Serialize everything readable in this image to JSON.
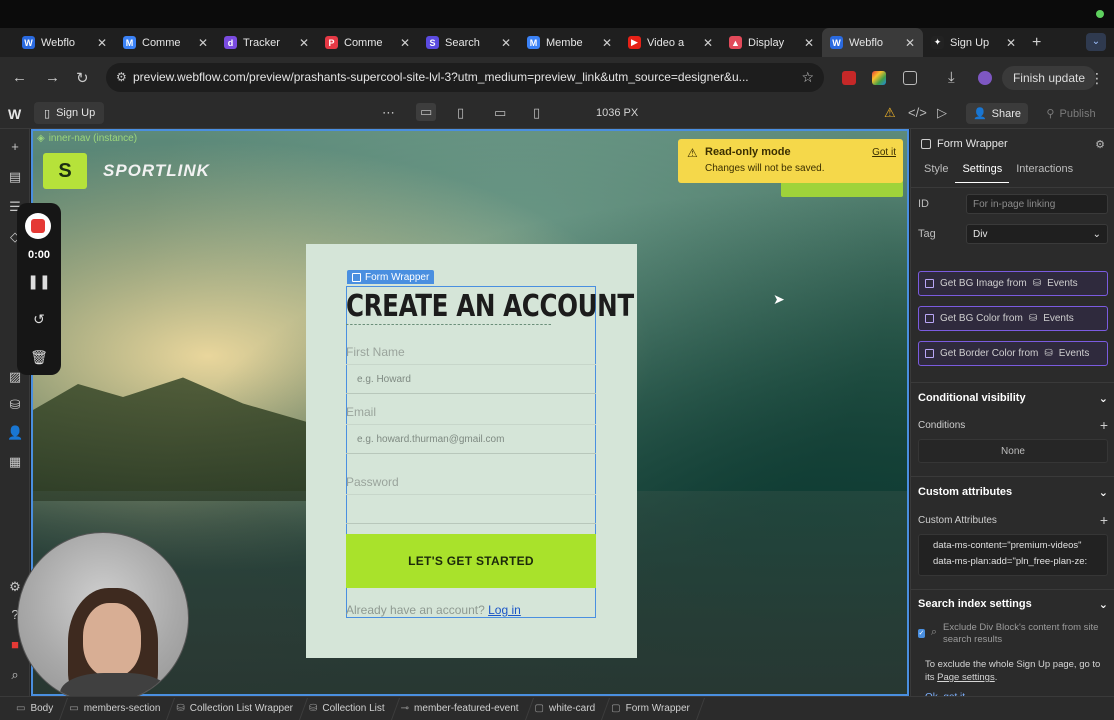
{
  "browser": {
    "tabs": [
      {
        "label": "Webflo",
        "favicon": "W",
        "color": "#2a6ae0",
        "active": false
      },
      {
        "label": "Comme",
        "favicon": "M",
        "color": "#3b82f6",
        "active": false
      },
      {
        "label": "Tracker",
        "favicon": "d",
        "color": "#7a4be0",
        "active": false
      },
      {
        "label": "Comme",
        "favicon": "P",
        "color": "#e53945",
        "active": false
      },
      {
        "label": "Search",
        "favicon": "S",
        "color": "#5b4be0",
        "active": false
      },
      {
        "label": "Membe",
        "favicon": "M",
        "color": "#3b82f6",
        "active": false
      },
      {
        "label": "Video a",
        "favicon": "▶",
        "color": "#e62117",
        "active": false
      },
      {
        "label": "Display",
        "favicon": "▲",
        "color": "#e24a5a",
        "active": false
      },
      {
        "label": "Webflo",
        "favicon": "W",
        "color": "#2a6ae0",
        "active": true
      },
      {
        "label": "Sign Up",
        "favicon": "✦",
        "color": "#222222",
        "active": false
      }
    ],
    "url": "preview.webflow.com/preview/prashants-supercool-site-lvl-3?utm_medium=preview_link&utm_source=designer&u...",
    "finish_update": "Finish update"
  },
  "designer": {
    "page_name": "Sign Up",
    "canvas_width": "1036 PX",
    "share_label": "Share",
    "publish_label": "Publish",
    "instance_label": "inner-nav (instance)"
  },
  "recorder": {
    "time": "0:00"
  },
  "site": {
    "brand": "SPORTLINK",
    "toast_title": "Read-only mode",
    "toast_sub": "Changes will not be saved.",
    "toast_action": "Got it",
    "selection_tag": "Form Wrapper",
    "form_title": "CREATE AN ACCOUNT",
    "fields": [
      {
        "label": "First Name",
        "placeholder": "e.g. Howard"
      },
      {
        "label": "Email",
        "placeholder": "e.g. howard.thurman@gmail.com"
      },
      {
        "label": "Password",
        "placeholder": ""
      }
    ],
    "cta": "LET'S GET STARTED",
    "already_text": "Already have an account?",
    "login_link": "Log in"
  },
  "panel": {
    "element_name": "Form Wrapper",
    "tabs": [
      "Style",
      "Settings",
      "Interactions"
    ],
    "id_label": "ID",
    "id_placeholder": "For in-page linking",
    "tag_label": "Tag",
    "tag_value": "Div",
    "bindings": [
      {
        "label": "Get BG Image from",
        "source": "Events"
      },
      {
        "label": "Get BG Color from",
        "source": "Events"
      },
      {
        "label": "Get Border Color from",
        "source": "Events"
      }
    ],
    "conditional_visibility": "Conditional visibility",
    "conditions_label": "Conditions",
    "conditions_value": "None",
    "custom_attributes_header": "Custom attributes",
    "custom_attributes_label": "Custom Attributes",
    "attributes": [
      "data-ms-content=\"premium-videos\"",
      "data-ms-plan:add=\"pln_free-plan-ze:"
    ],
    "search_index_header": "Search index settings",
    "exclude_text": "Exclude Div Block's content from site search results",
    "tip_text": "To exclude the whole Sign Up page, go to its",
    "tip_link": "Page settings",
    "ok_got_it": "Ok, got it"
  },
  "breadcrumbs": [
    "Body",
    "members-section",
    "Collection List Wrapper",
    "Collection List",
    "member-featured-event",
    "white-card",
    "Form Wrapper"
  ]
}
